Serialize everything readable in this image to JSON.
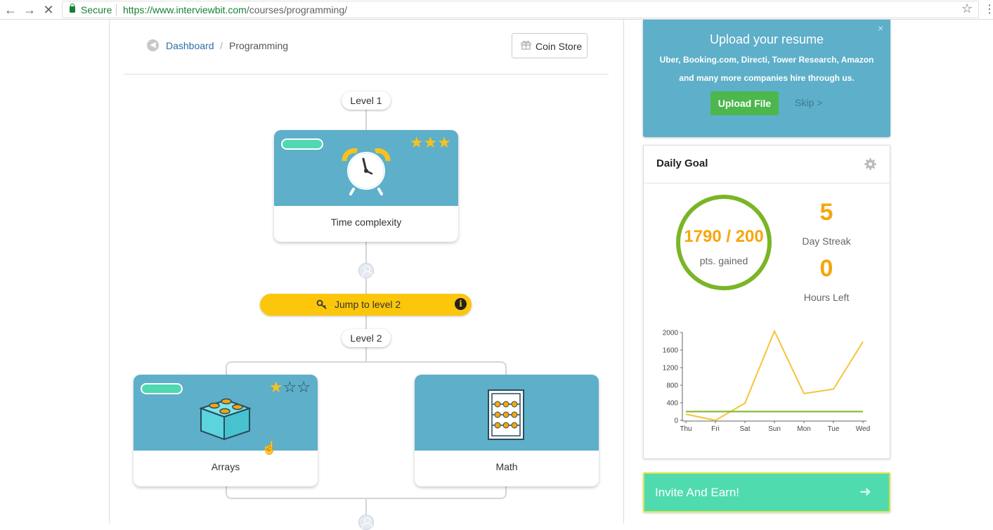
{
  "browser": {
    "secure_label": "Secure",
    "url_scheme_host": "https://www.interviewbit.com",
    "url_path": "/courses/programming/"
  },
  "breadcrumb": {
    "root": "Dashboard",
    "separator": "/",
    "current": "Programming"
  },
  "coin_store": {
    "label": "Coin Store"
  },
  "levels": [
    {
      "label": "Level 1"
    },
    {
      "label": "Level 2"
    }
  ],
  "cards": [
    {
      "title": "Time complexity",
      "stars_filled": 3,
      "stars_total": 3,
      "icon": "alarm-clock-icon"
    },
    {
      "title": "Arrays",
      "stars_filled": 1,
      "stars_total": 3,
      "icon": "lego-brick-icon"
    },
    {
      "title": "Math",
      "icon": "abacus-icon"
    }
  ],
  "jump": {
    "label": "Jump to level 2",
    "info": "i"
  },
  "upload": {
    "title": "Upload your resume",
    "subtitle": "Uber, Booking.com, Directi, Tower Research, Amazon and many more companies hire through us.",
    "button": "Upload File",
    "skip": "Skip >",
    "close": "×"
  },
  "daily_goal": {
    "title": "Daily Goal",
    "points": "1790 / 200",
    "points_label": "pts. gained",
    "streak_value": "5",
    "streak_label": "Day Streak",
    "hours_value": "0",
    "hours_label": "Hours Left"
  },
  "chart_data": {
    "type": "line",
    "categories": [
      "Thu",
      "Fri",
      "Sat",
      "Sun",
      "Mon",
      "Tue",
      "Wed"
    ],
    "series": [
      {
        "values": [
          140,
          0,
          390,
          2030,
          610,
          710,
          1790
        ],
        "color": "#f8c33a"
      },
      {
        "values": [
          200,
          200,
          200,
          200,
          200,
          200,
          200
        ],
        "color": "#7bb526"
      }
    ],
    "y_ticks": [
      0,
      400,
      800,
      1200,
      1600,
      2000
    ],
    "ylim": [
      0,
      2000
    ],
    "grid": false
  },
  "invite": {
    "label": "Invite And Earn!",
    "arrow": "➜"
  },
  "colors": {
    "card_top": "#5eafc9",
    "accent_yellow": "#fcc70a",
    "goal_orange": "#f6a60c",
    "ring_green": "#7bb526",
    "invite_green": "#4fdbae"
  }
}
